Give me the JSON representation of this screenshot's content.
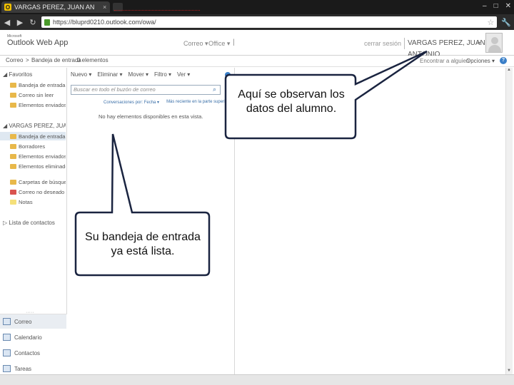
{
  "browser": {
    "tab_title": "VARGAS PEREZ, JUAN AN",
    "tab_close": "×",
    "url": "https://bluprd0210.outlook.com/owa/",
    "back": "◀",
    "forward": "▶",
    "reload": "↻",
    "star": "☆",
    "wrench": "🔧",
    "win_min": "–",
    "win_max": "□",
    "win_close": "✕"
  },
  "header": {
    "logo_small": "Microsoft",
    "logo": "Outlook Web App",
    "nav_correo": "Correo ▾",
    "nav_office": "Office ▾",
    "separator": "|",
    "logout": "cerrar sesión",
    "user_name": "VARGAS PEREZ, JUAN ANTONIO",
    "user_dropdown": "▾"
  },
  "subheader": {
    "breadcrumb_1": "Correo",
    "breadcrumb_sep": ">",
    "breadcrumb_2": "Bandeja de entrada",
    "breadcrumb_count": "0 elementos",
    "find_people": "Encontrar a alguien",
    "options": "Opciones ▾",
    "help": "?"
  },
  "leftnav": {
    "favorites_header": "◢ Favoritos",
    "favorites": [
      {
        "label": "Bandeja de entrada"
      },
      {
        "label": "Correo sin leer"
      },
      {
        "label": "Elementos enviados"
      }
    ],
    "user_header": "◢ VARGAS PEREZ, JUAN AN",
    "folders": [
      {
        "label": "Bandeja de entrada"
      },
      {
        "label": "Borradores"
      },
      {
        "label": "Elementos enviados"
      },
      {
        "label": "Elementos eliminados"
      },
      {
        "label": "Carpetas de búsqueda"
      },
      {
        "label": "Correo no deseado"
      },
      {
        "label": "Notas"
      }
    ],
    "contacts_header": "▷ Lista de contactos",
    "bottom_grip": "·····",
    "bottom": [
      {
        "label": "Correo"
      },
      {
        "label": "Calendario"
      },
      {
        "label": "Contactos"
      },
      {
        "label": "Tareas"
      }
    ]
  },
  "messages": {
    "toolbar": {
      "new": "Nuevo ▾",
      "delete": "Eliminar ▾",
      "move": "Mover ▾",
      "filter": "Filtro ▾",
      "view": "Ver ▾"
    },
    "search_placeholder": "Buscar en todo el buzón de correo",
    "search_icon": "⌕",
    "sort_by": "Conversaciones por: Fecha ▾",
    "sort_order": "Más reciente en la parte superior",
    "empty": "No hay elementos disponibles en esta vista."
  },
  "scroll": {
    "up": "▲",
    "down": "▼"
  },
  "callouts": {
    "student_data": "Aquí se observan los datos del alumno.",
    "inbox_ready": "Su bandeja de entrada ya está lista."
  }
}
